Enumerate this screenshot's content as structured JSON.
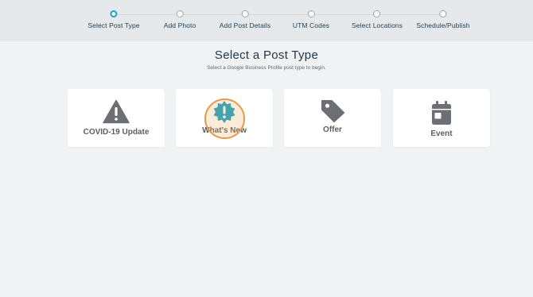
{
  "steps": [
    {
      "label": "Select Post Type",
      "active": true
    },
    {
      "label": "Add Photo",
      "active": false
    },
    {
      "label": "Add Post Details",
      "active": false
    },
    {
      "label": "UTM Codes",
      "active": false
    },
    {
      "label": "Select Locations",
      "active": false
    },
    {
      "label": "Schedule/Publish",
      "active": false
    }
  ],
  "page": {
    "title": "Select a Post Type",
    "subtitle": "Select a Google Business Profile post type to begin."
  },
  "post_types": [
    {
      "label": "COVID-19 Update",
      "icon": "warning-triangle-icon"
    },
    {
      "label": "What's New",
      "icon": "new-badge-icon"
    },
    {
      "label": "Offer",
      "icon": "price-tag-icon"
    },
    {
      "label": "Event",
      "icon": "calendar-icon"
    }
  ],
  "colors": {
    "accent": "#14a3c7",
    "icon_gray": "#6c6f73",
    "highlight": "#e59a4a"
  }
}
